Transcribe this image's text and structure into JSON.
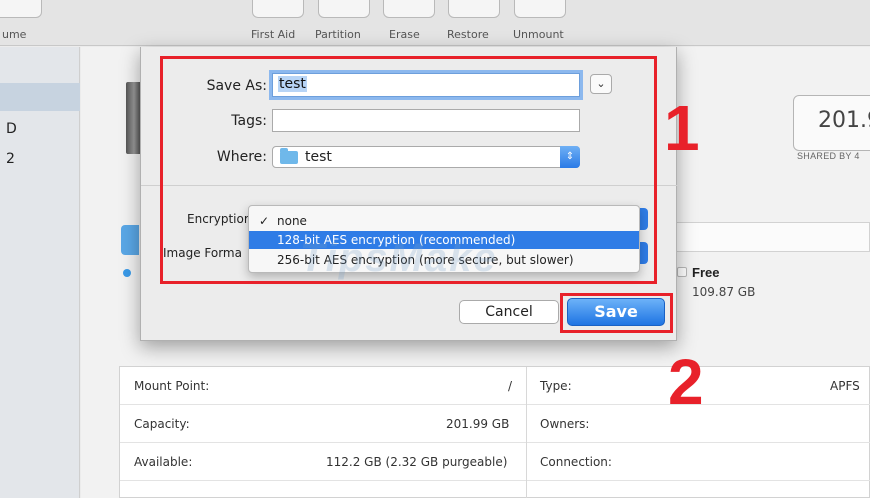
{
  "toolbar": {
    "left_label": "ume",
    "buttons": [
      {
        "label": "First Aid"
      },
      {
        "label": "Partition"
      },
      {
        "label": "Erase"
      },
      {
        "label": "Restore"
      },
      {
        "label": "Unmount"
      }
    ]
  },
  "sidebar": {
    "items": [
      {
        "label": "D"
      },
      {
        "label": "2"
      }
    ]
  },
  "volume": {
    "capacity_display": "201.9",
    "shared_label": "SHARED BY 4",
    "free_label": "Free",
    "free_value": "109.87 GB"
  },
  "dialog": {
    "save_as_label": "Save As:",
    "save_as_value": "test",
    "tags_label": "Tags:",
    "tags_value": "",
    "where_label": "Where:",
    "where_value": "test",
    "expand_icon": "chevron-down-icon",
    "encryption_label": "Encryptior",
    "image_format_label": "Image Forma",
    "encryption_options": [
      {
        "label": "none",
        "checked": true
      },
      {
        "label": "128-bit AES encryption (recommended)",
        "highlighted": true
      },
      {
        "label": "256-bit AES encryption (more secure, but slower)"
      }
    ],
    "cancel_label": "Cancel",
    "save_label": "Save"
  },
  "info_table": {
    "left": [
      {
        "label": "Mount Point:",
        "value": "/"
      },
      {
        "label": "Capacity:",
        "value": "201.99 GB"
      },
      {
        "label": "Available:",
        "value": "112.2 GB (2.32 GB purgeable)"
      }
    ],
    "right": [
      {
        "label": "Type:",
        "value": "APFS"
      },
      {
        "label": "Owners:",
        "value": ""
      },
      {
        "label": "Connection:",
        "value": ""
      }
    ]
  },
  "annotations": {
    "step1": "1",
    "step2": "2",
    "color": "#e8212a"
  },
  "watermark": "TipsMake",
  "colors": {
    "accent": "#2f7ce6",
    "annotation": "#e8212a"
  }
}
